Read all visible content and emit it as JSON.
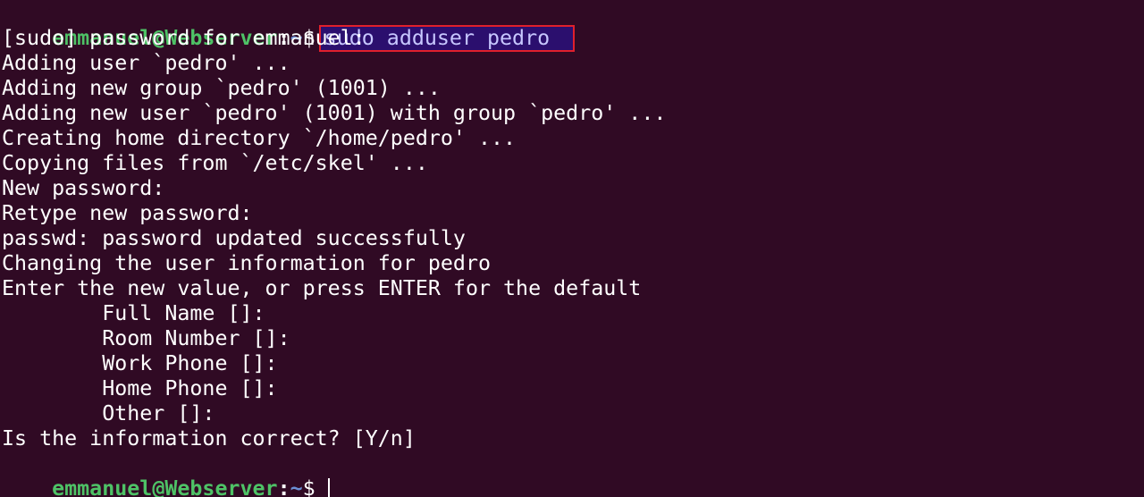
{
  "prompt": {
    "user_host": "emmanuel@Webserver",
    "separator": ":",
    "path": "~",
    "symbol": "$"
  },
  "command": "sudo adduser pedro",
  "output": [
    "[sudo] password for emmanuel:",
    "Adding user `pedro' ...",
    "Adding new group `pedro' (1001) ...",
    "Adding new user `pedro' (1001) with group `pedro' ...",
    "Creating home directory `/home/pedro' ...",
    "Copying files from `/etc/skel' ...",
    "New password:",
    "Retype new password:",
    "passwd: password updated successfully",
    "Changing the user information for pedro",
    "Enter the new value, or press ENTER for the default",
    "        Full Name []:",
    "        Room Number []:",
    "        Work Phone []:",
    "        Home Phone []:",
    "        Other []:",
    "Is the information correct? [Y/n]"
  ],
  "colors": {
    "background": "#300a24",
    "user_host": "#4ec266",
    "path": "#6b8fd6",
    "highlight_border": "#e0202c",
    "highlight_fill": "#2b0f6e"
  }
}
